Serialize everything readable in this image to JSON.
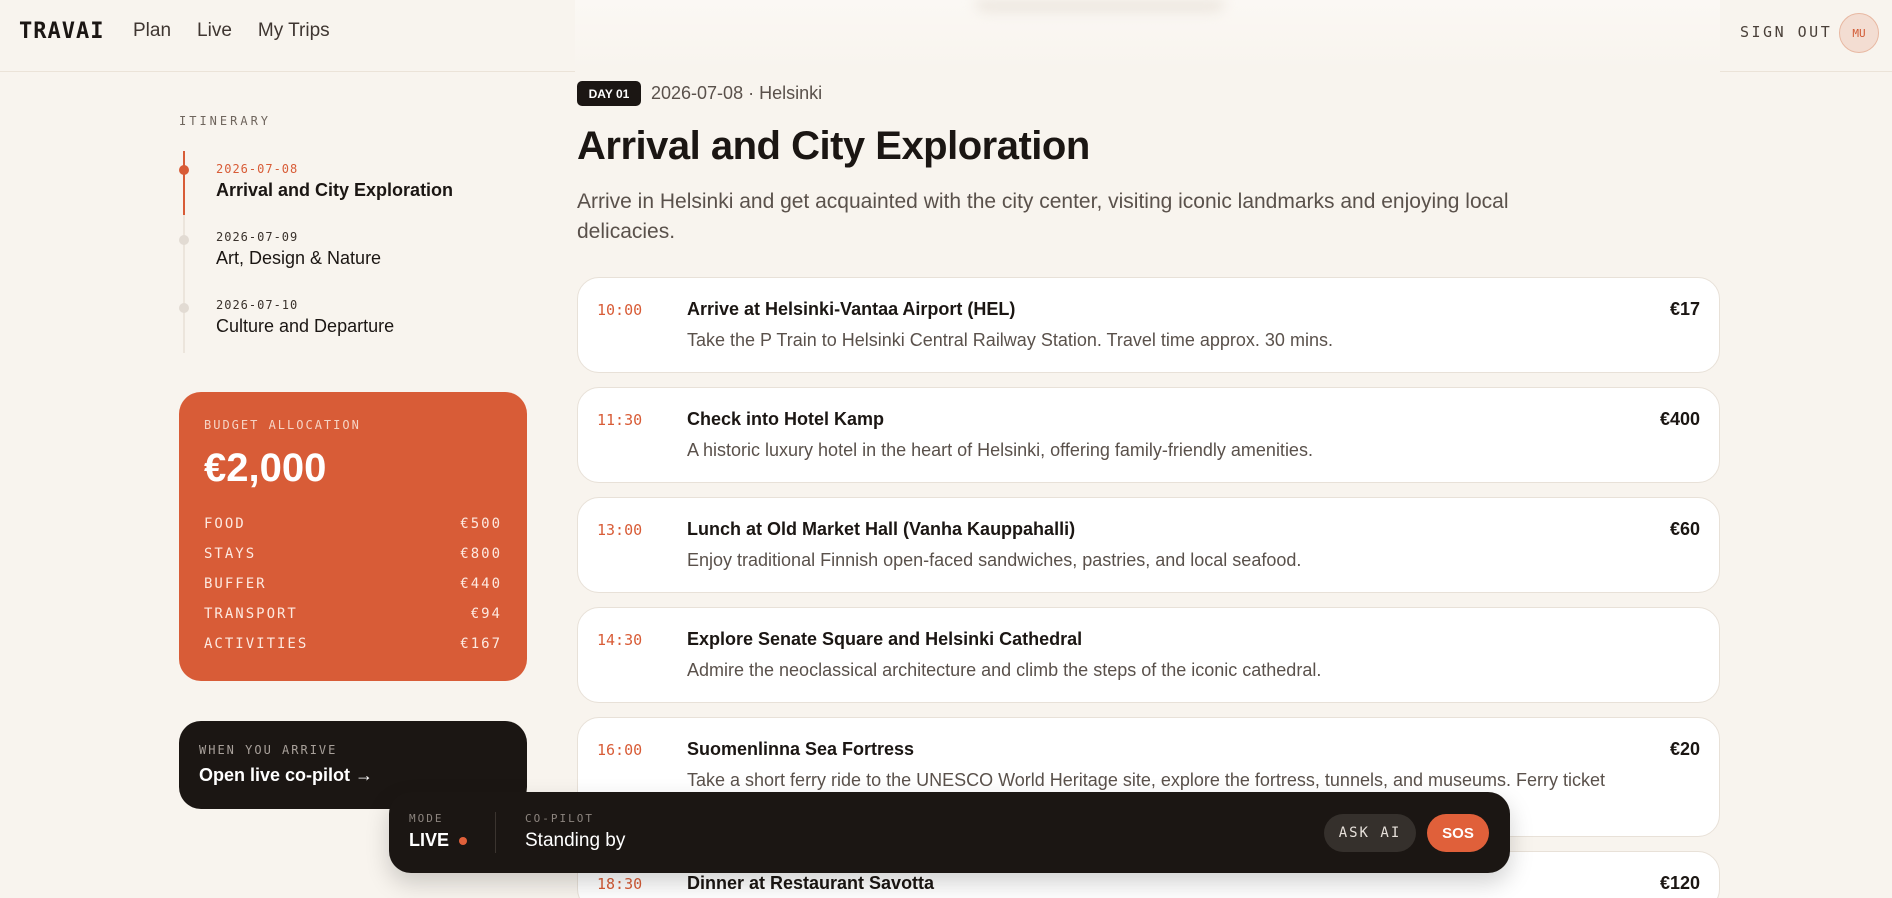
{
  "app": {
    "logo": "TRAVAI"
  },
  "nav": {
    "items": [
      "Plan",
      "Live",
      "My Trips"
    ]
  },
  "header": {
    "sign_out": "SIGN OUT",
    "avatar": "MU"
  },
  "sidebar": {
    "itinerary_label": "ITINERARY",
    "days": [
      {
        "date": "2026-07-08",
        "title": "Arrival and City Exploration",
        "active": true
      },
      {
        "date": "2026-07-09",
        "title": "Art, Design & Nature",
        "active": false
      },
      {
        "date": "2026-07-10",
        "title": "Culture and Departure",
        "active": false
      }
    ],
    "budget": {
      "label": "BUDGET ALLOCATION",
      "amount": "€2,000",
      "rows": [
        {
          "name": "FOOD",
          "value": "€500"
        },
        {
          "name": "STAYS",
          "value": "€800"
        },
        {
          "name": "BUFFER",
          "value": "€440"
        },
        {
          "name": "TRANSPORT",
          "value": "€94"
        },
        {
          "name": "ACTIVITIES",
          "value": "€167"
        }
      ]
    },
    "copilot": {
      "label": "WHEN YOU ARRIVE",
      "link": "Open live co-pilot →"
    }
  },
  "main": {
    "day_badge": "DAY 01",
    "day_meta": "2026-07-08 · Helsinki",
    "title": "Arrival and City Exploration",
    "description": "Arrive in Helsinki and get acquainted with the city center, visiting iconic landmarks and enjoying local delicacies.",
    "activities": [
      {
        "time": "10:00",
        "title": "Arrive at Helsinki-Vantaa Airport (HEL)",
        "desc": "Take the P Train to Helsinki Central Railway Station. Travel time approx. 30 mins.",
        "price": "€17"
      },
      {
        "time": "11:30",
        "title": "Check into Hotel Kamp",
        "desc": "A historic luxury hotel in the heart of Helsinki, offering family-friendly amenities.",
        "price": "€400"
      },
      {
        "time": "13:00",
        "title": "Lunch at Old Market Hall (Vanha Kauppahalli)",
        "desc": "Enjoy traditional Finnish open-faced sandwiches, pastries, and local seafood.",
        "price": "€60"
      },
      {
        "time": "14:30",
        "title": "Explore Senate Square and Helsinki Cathedral",
        "desc": "Admire the neoclassical architecture and climb the steps of the iconic cathedral.",
        "price": ""
      },
      {
        "time": "16:00",
        "title": "Suomenlinna Sea Fortress",
        "desc": "Take a short ferry ride to the UNESCO World Heritage site, explore the fortress, tunnels, and museums. Ferry ticket included in Helsinki Card.",
        "price": "€20"
      },
      {
        "time": "18:30",
        "title": "Dinner at Restaurant Savotta",
        "desc": "",
        "price": "€120"
      }
    ]
  },
  "bottombar": {
    "mode_label": "MODE",
    "mode_value": "LIVE",
    "copilot_label": "CO-PILOT",
    "copilot_value": "Standing by",
    "ask_ai": "ASK AI",
    "sos": "SOS"
  }
}
